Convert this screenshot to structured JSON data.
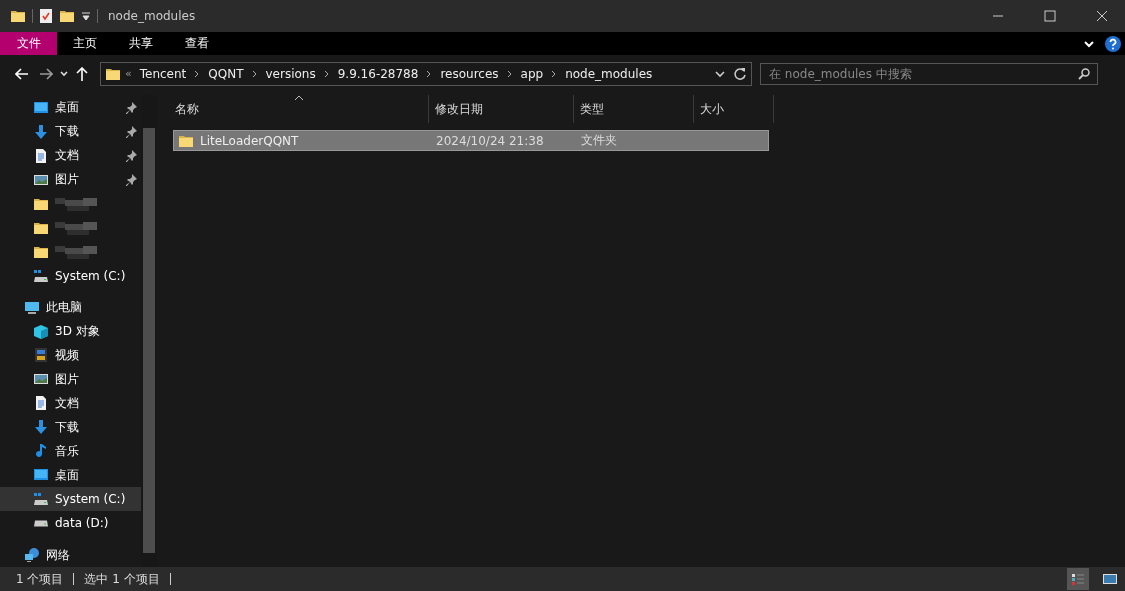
{
  "window": {
    "title": "node_modules"
  },
  "ribbon": {
    "tabs": [
      {
        "label": "文件",
        "selected": true
      },
      {
        "label": "主页",
        "selected": false
      },
      {
        "label": "共享",
        "selected": false
      },
      {
        "label": "查看",
        "selected": false
      }
    ]
  },
  "address": {
    "overflow": "«",
    "segments": [
      "Tencent",
      "QQNT",
      "versions",
      "9.9.16-28788",
      "resources",
      "app",
      "node_modules"
    ]
  },
  "search": {
    "placeholder": "在 node_modules 中搜索"
  },
  "sidebar": {
    "quick_access": [
      {
        "label": "桌面",
        "kind": "desktop",
        "pinned": true,
        "selected": false
      },
      {
        "label": "下载",
        "kind": "download",
        "pinned": true,
        "selected": false
      },
      {
        "label": "文档",
        "kind": "document",
        "pinned": true,
        "selected": false
      },
      {
        "label": "图片",
        "kind": "pictures",
        "pinned": true,
        "selected": false
      },
      {
        "kind": "blurred",
        "pinned": false,
        "selected": false
      },
      {
        "kind": "blurred",
        "pinned": false,
        "selected": false
      },
      {
        "kind": "blurred",
        "pinned": false,
        "selected": false
      },
      {
        "label": "System (C:)",
        "kind": "drive-system",
        "pinned": false,
        "selected": false
      }
    ],
    "tree": [
      {
        "label": "此电脑",
        "kind": "computer",
        "selected": false,
        "children": [
          {
            "label": "3D 对象",
            "kind": "cube",
            "selected": false
          },
          {
            "label": "视频",
            "kind": "video",
            "selected": false
          },
          {
            "label": "图片",
            "kind": "pictures",
            "selected": false
          },
          {
            "label": "文档",
            "kind": "document",
            "selected": false
          },
          {
            "label": "下载",
            "kind": "download",
            "selected": false
          },
          {
            "label": "音乐",
            "kind": "music",
            "selected": false
          },
          {
            "label": "桌面",
            "kind": "desktop",
            "selected": false
          },
          {
            "label": "System (C:)",
            "kind": "drive-system",
            "selected": true
          },
          {
            "label": "data (D:)",
            "kind": "drive",
            "selected": false
          }
        ]
      },
      {
        "label": "网络",
        "kind": "network",
        "selected": false
      }
    ]
  },
  "table": {
    "columns": [
      "名称",
      "修改日期",
      "类型",
      "大小"
    ],
    "rows": [
      {
        "name": "LiteLoaderQQNT",
        "modified": "2024/10/24 21:38",
        "type": "文件夹",
        "selected": true
      }
    ]
  },
  "status_bar": {
    "items": "1 个项目",
    "selection": "选中 1 个项目"
  }
}
